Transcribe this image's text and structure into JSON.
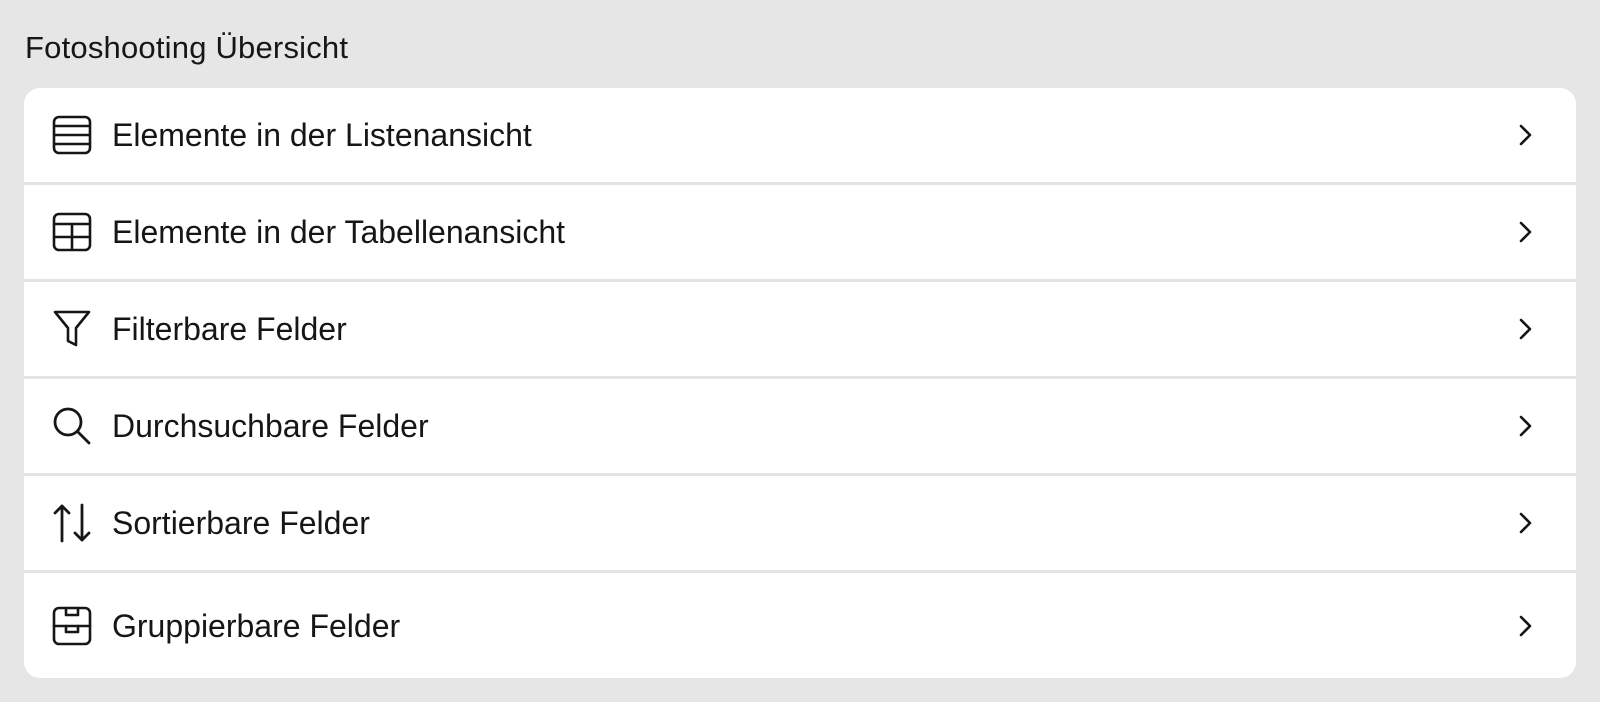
{
  "section": {
    "title": "Fotoshooting Übersicht"
  },
  "items": [
    {
      "label": "Elemente in der Listenansicht",
      "icon": "list-view-icon"
    },
    {
      "label": "Elemente in der Tabellenansicht",
      "icon": "table-view-icon"
    },
    {
      "label": "Filterbare Felder",
      "icon": "filter-icon"
    },
    {
      "label": "Durchsuchbare Felder",
      "icon": "search-icon"
    },
    {
      "label": "Sortierbare Felder",
      "icon": "sort-arrows-icon"
    },
    {
      "label": "Gruppierbare Felder",
      "icon": "group-archive-icon"
    }
  ],
  "colors": {
    "background": "#e6e6e6",
    "card": "#ffffff",
    "text": "#161616",
    "divider": "#e3e3e3"
  }
}
